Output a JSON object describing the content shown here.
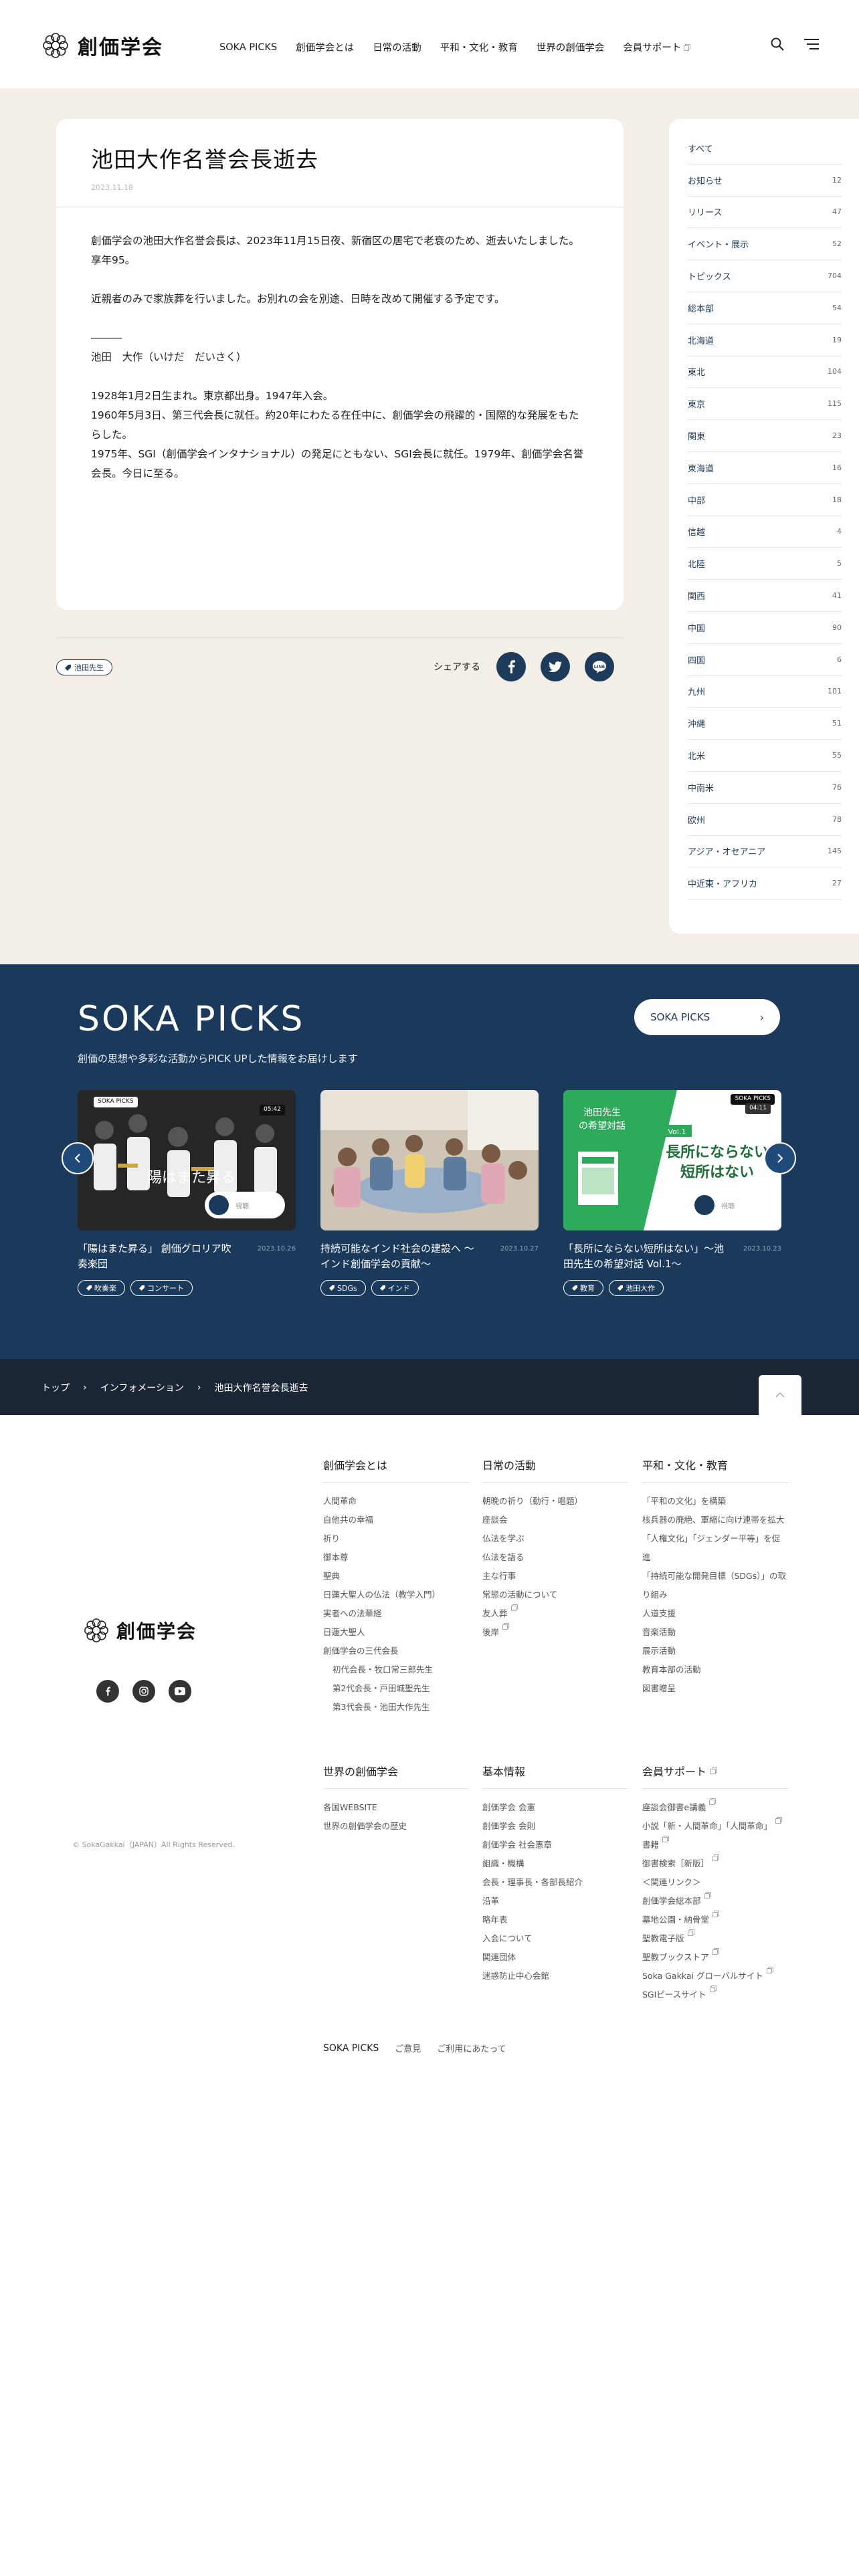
{
  "header": {
    "logo_text": "創価学会",
    "nav": [
      {
        "label": "SOKA PICKS",
        "external": false
      },
      {
        "label": "創価学会とは",
        "external": false
      },
      {
        "label": "日常の活動",
        "external": false
      },
      {
        "label": "平和・文化・教育",
        "external": false
      },
      {
        "label": "世界の創価学会",
        "external": false
      },
      {
        "label": "会員サポート",
        "external": true
      }
    ],
    "icons": [
      "search-icon",
      "menu-icon"
    ]
  },
  "article": {
    "title": "池田大作名誉会長逝去",
    "date": "2023.11.18",
    "paragraphs": [
      [
        "創価学会の池田大作名誉会長は、2023年11月15日夜、新宿区の居宅で老衰のため、逝去いたしました。享年95。"
      ],
      [
        "近親者のみで家族葬を行いました。お別れの会を別途、日時を改めて開催する予定です。"
      ],
      [
        "―――",
        "池田　大作（いけだ　だいさく）"
      ],
      [
        "1928年1月2日生まれ。東京都出身。1947年入会。",
        "1960年5月3日、第三代会長に就任。約20年にわたる在任中に、創価学会の飛躍的・国際的な発展をもたらした。",
        "1975年、SGI（創価学会インタナショナル）の発足にともない、SGI会長に就任。1979年、創価学会名誉会長。今日に至る。"
      ]
    ],
    "tag": "池田先生",
    "share_label": "シェアする",
    "share_icons": [
      "facebook-icon",
      "twitter-icon",
      "line-icon"
    ]
  },
  "sidebar": {
    "categories": [
      {
        "label": "すべて",
        "count": ""
      },
      {
        "label": "お知らせ",
        "count": "12"
      },
      {
        "label": "リリース",
        "count": "47"
      },
      {
        "label": "イベント・展示",
        "count": "52"
      },
      {
        "label": "トピックス",
        "count": "704"
      },
      {
        "label": "総本部",
        "count": "54"
      },
      {
        "label": "北海道",
        "count": "19"
      },
      {
        "label": "東北",
        "count": "104"
      },
      {
        "label": "東京",
        "count": "115"
      },
      {
        "label": "関東",
        "count": "23"
      },
      {
        "label": "東海道",
        "count": "16"
      },
      {
        "label": "中部",
        "count": "18"
      },
      {
        "label": "信越",
        "count": "4"
      },
      {
        "label": "北陸",
        "count": "5"
      },
      {
        "label": "関西",
        "count": "41"
      },
      {
        "label": "中国",
        "count": "90"
      },
      {
        "label": "四国",
        "count": "6"
      },
      {
        "label": "九州",
        "count": "101"
      },
      {
        "label": "沖縄",
        "count": "51"
      },
      {
        "label": "北米",
        "count": "55"
      },
      {
        "label": "中南米",
        "count": "76"
      },
      {
        "label": "欧州",
        "count": "78"
      },
      {
        "label": "アジア・オセアニア",
        "count": "145"
      },
      {
        "label": "中近東・アフリカ",
        "count": "27"
      }
    ]
  },
  "picks": {
    "title": "SOKA PICKS",
    "subtitle": "創価の思想や多彩な活動からPICK UPした情報をお届けします",
    "more_label": "SOKA PICKS",
    "cards": [
      {
        "badge": "SOKA PICKS",
        "duration": "05:42",
        "overlay": "陽はまた昇る",
        "title": "「陽はまた昇る」 創価グロリア吹奏楽団",
        "date": "2023.10.26",
        "tags": [
          "吹奏楽",
          "コンサート"
        ]
      },
      {
        "badge": "",
        "duration": "",
        "overlay": "",
        "title": "持続可能なインド社会の建設へ 〜インド創価学会の貢献〜",
        "date": "2023.10.27",
        "tags": [
          "SDGs",
          "インド"
        ]
      },
      {
        "badge": "SOKA PICKS",
        "duration": "04:11",
        "overlay": "池田先生の希望対話",
        "overlay2": "長所にならない短所はない",
        "vol": "Vol.1",
        "title": "「長所にならない短所はない」〜池田先生の希望対話 Vol.1〜",
        "date": "2023.10.23",
        "tags": [
          "教育",
          "池田大作"
        ]
      }
    ],
    "play_text": "視聴"
  },
  "breadcrumb": [
    "トップ",
    "インフォメーション",
    "池田大作名誉会長逝去"
  ],
  "footer": {
    "logo_text": "創価学会",
    "social_icons": [
      "facebook-icon",
      "instagram-icon",
      "youtube-icon"
    ],
    "copyright": "© SokaGakkai（JAPAN）All Rights Reserved.",
    "col1": {
      "head": "創価学会とは",
      "items": [
        {
          "label": "人間革命"
        },
        {
          "label": "自他共の幸福"
        },
        {
          "label": "祈り"
        },
        {
          "label": "御本尊"
        },
        {
          "label": "聖典"
        },
        {
          "label": "日蓮大聖人の仏法（教学入門）"
        },
        {
          "label": "実者への法華経"
        },
        {
          "label": "日蓮大聖人"
        },
        {
          "label": "創価学会の三代会長"
        },
        {
          "label": "初代会長・牧口常三郎先生",
          "sub": true
        },
        {
          "label": "第2代会長・戸田城聖先生",
          "sub": true
        },
        {
          "label": "第3代会長・池田大作先生",
          "sub": true
        }
      ]
    },
    "col2": {
      "head": "日常の活動",
      "items": [
        {
          "label": "朝晩の祈り（勤行・唱題）"
        },
        {
          "label": "座談会"
        },
        {
          "label": "仏法を学ぶ"
        },
        {
          "label": "仏法を語る"
        },
        {
          "label": "主な行事"
        },
        {
          "label": "常態の活動について"
        },
        {
          "label": "友人葬",
          "ext": true
        },
        {
          "label": "後岸",
          "ext": true
        }
      ]
    },
    "col3": {
      "head": "平和・文化・教育",
      "items": [
        {
          "label": "「平和の文化」を構築"
        },
        {
          "label": "核兵器の廃絶、軍縮に向け連帯を拡大"
        },
        {
          "label": "「人権文化」「ジェンダー平等」を促進"
        },
        {
          "label": "「持続可能な開発目標（SDGs）」の取り組み"
        },
        {
          "label": "人道支援"
        },
        {
          "label": "音楽活動"
        },
        {
          "label": "展示活動"
        },
        {
          "label": "教育本部の活動"
        },
        {
          "label": "図書贈呈"
        }
      ]
    },
    "col4": {
      "head": "世界の創価学会",
      "items": [
        {
          "label": "各国WEBSITE"
        },
        {
          "label": "世界の創価学会の歴史"
        }
      ]
    },
    "col5": {
      "head": "基本情報",
      "items": [
        {
          "label": "創価学会 会憲"
        },
        {
          "label": "創価学会 会則"
        },
        {
          "label": "創価学会 社会憲章"
        },
        {
          "label": "組織・機構"
        },
        {
          "label": "会長・理事長・各部長紹介"
        },
        {
          "label": "沿革"
        },
        {
          "label": "略年表"
        },
        {
          "label": "入会について"
        },
        {
          "label": "関連団体"
        },
        {
          "label": "迷惑防止中心会館"
        }
      ]
    },
    "col6": {
      "head": "会員サポート",
      "head_ext": true,
      "items": [
        {
          "label": "座談会御書e講義",
          "ext": true
        },
        {
          "label": "小説「新・人間革命」「人間革命」",
          "ext": true
        },
        {
          "label": "書籍",
          "ext": true
        },
        {
          "label": "御書検索［新版］",
          "ext": true
        },
        {
          "label": "＜関連リンク＞"
        },
        {
          "label": "創価学会総本部",
          "ext": true
        },
        {
          "label": "墓地公園・納骨堂",
          "ext": true
        },
        {
          "label": "聖教電子版",
          "ext": true
        },
        {
          "label": "聖教ブックストア",
          "ext": true
        },
        {
          "label": "Soka Gakkai グローバルサイト",
          "ext": true
        },
        {
          "label": "SGIピースサイト",
          "ext": true
        }
      ]
    },
    "bottom_links": [
      "SOKA PICKS",
      "ご意見",
      "ご利用にあたって"
    ]
  }
}
